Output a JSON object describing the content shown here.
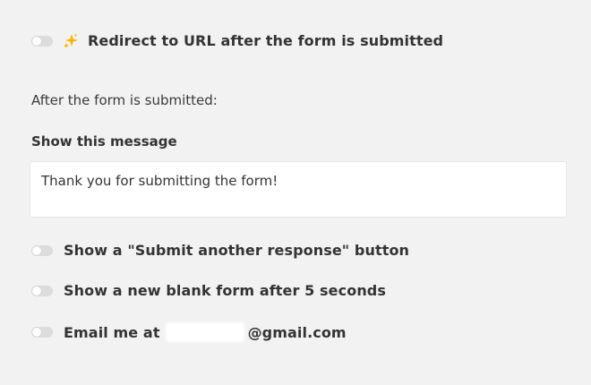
{
  "redirect": {
    "label": "Redirect to URL after the form is submitted",
    "enabled": false,
    "icon": "sparkle-icon",
    "icon_color": "#f5b400"
  },
  "after_submit_label": "After the form is submitted:",
  "message": {
    "label": "Show this message",
    "value": "Thank you for submitting the form!"
  },
  "options": {
    "submit_another": {
      "label": "Show a \"Submit another response\" button",
      "enabled": false
    },
    "blank_form": {
      "label": "Show a new blank form after 5 seconds",
      "enabled": false
    },
    "email": {
      "prefix": "Email me at",
      "suffix": "@gmail.com",
      "enabled": false
    }
  },
  "colors": {
    "background": "#f2f2f2",
    "toggle_off": "#dcdcdc",
    "text": "#333333"
  }
}
